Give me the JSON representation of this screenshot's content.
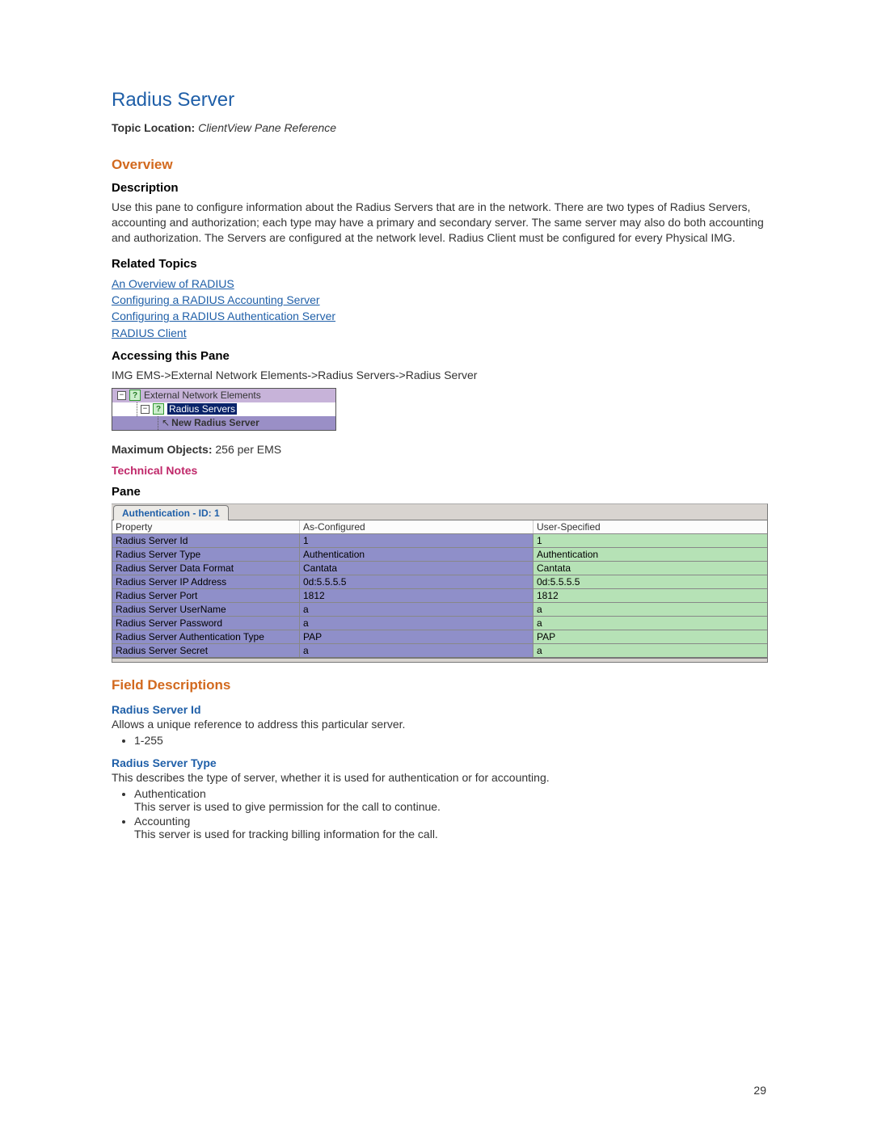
{
  "page_number": "29",
  "title": "Radius Server",
  "topic_loc_label": "Topic Location:",
  "topic_loc_value": "ClientView Pane Reference",
  "sections": {
    "overview": "Overview",
    "field_desc": "Field Descriptions"
  },
  "subs": {
    "description": "Description",
    "related": "Related Topics",
    "access": "Accessing this Pane",
    "pane": "Pane"
  },
  "description_text": "Use this pane to configure information about the Radius Servers that are in the network. There are two types of Radius Servers, accounting and authorization; each type may have a primary and secondary server. The same server may also do both accounting and authorization. The Servers are configured at the network level. Radius Client must be configured for every Physical IMG.",
  "related_links": [
    "An Overview of RADIUS",
    "Configuring a RADIUS Accounting Server",
    "Configuring a RADIUS Authentication Server",
    "RADIUS Client"
  ],
  "access_path": "IMG EMS->External Network Elements->Radius Servers->Radius Server",
  "tree": {
    "row1": "External Network Elements",
    "row2": "Radius Servers",
    "row3": "New Radius Server"
  },
  "max_objects_label": "Maximum Objects:",
  "max_objects_value": "256 per EMS",
  "tech_notes": "Technical Notes",
  "pane_tab": "Authentication - ID: 1",
  "pane_headers": {
    "c1": "Property",
    "c2": "As-Configured",
    "c3": "User-Specified"
  },
  "pane_rows": [
    {
      "p": "Radius Server Id",
      "c": "1",
      "u": "1"
    },
    {
      "p": "Radius Server Type",
      "c": "Authentication",
      "u": "Authentication"
    },
    {
      "p": "Radius Server Data Format",
      "c": "Cantata",
      "u": "Cantata"
    },
    {
      "p": "Radius Server IP Address",
      "c": "0d:5.5.5.5",
      "u": "0d:5.5.5.5"
    },
    {
      "p": "Radius Server Port",
      "c": "1812",
      "u": "1812"
    },
    {
      "p": "Radius Server UserName",
      "c": "a",
      "u": "a"
    },
    {
      "p": "Radius Server Password",
      "c": "a",
      "u": "a"
    },
    {
      "p": "Radius Server Authentication Type",
      "c": "PAP",
      "u": "PAP"
    },
    {
      "p": "Radius Server Secret",
      "c": "a",
      "u": "a"
    }
  ],
  "fields": {
    "id": {
      "name": "Radius Server Id",
      "text": "Allows a unique reference to address this particular server.",
      "bullet1": "1-255"
    },
    "type": {
      "name": "Radius Server Type",
      "text": "This describes the type of server, whether it is used for authentication or for accounting.",
      "b1": "Authentication",
      "b1_text": "This server is used to give permission for the call to continue.",
      "b2": "Accounting",
      "b2_text": "This server is used for tracking billing information for the call."
    }
  }
}
